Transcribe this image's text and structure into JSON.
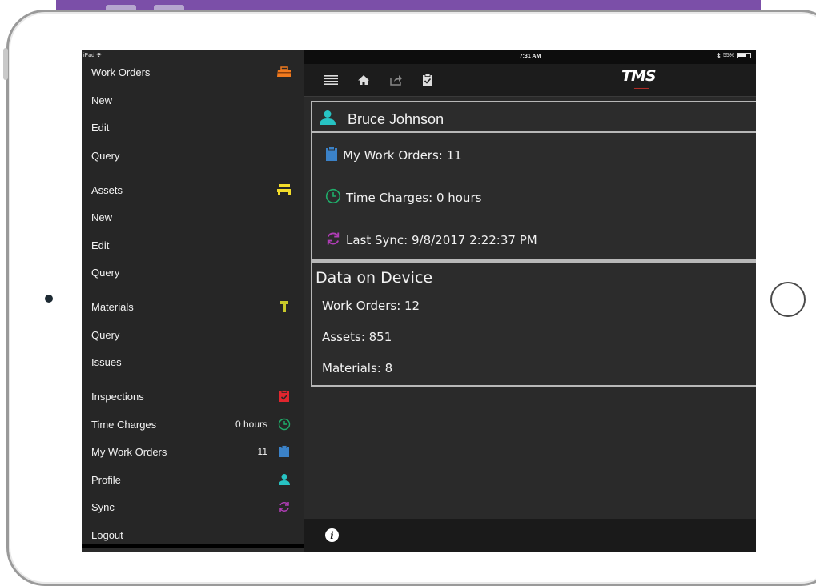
{
  "status_bar": {
    "carrier": "iPad",
    "time": "7:31 AM",
    "battery": "55%"
  },
  "logo": {
    "text": "TMS"
  },
  "sidebar": {
    "work_orders": {
      "label": "Work Orders",
      "icon": "toolbox-icon",
      "color": "#f07a1e"
    },
    "wo_new": "New",
    "wo_edit": "Edit",
    "wo_query": "Query",
    "assets": {
      "label": "Assets",
      "icon": "assets-icon",
      "color": "#f2dc2a"
    },
    "as_new": "New",
    "as_edit": "Edit",
    "as_query": "Query",
    "materials": {
      "label": "Materials",
      "icon": "materials-icon",
      "color": "#c8c82a"
    },
    "mat_query": "Query",
    "mat_issues": "Issues",
    "inspections": {
      "label": "Inspections",
      "icon": "inspection-clipboard-icon",
      "color": "#e0262e"
    },
    "time_charges": {
      "label": "Time Charges",
      "value": "0 hours",
      "icon": "clock-icon",
      "color": "#1fae6a"
    },
    "my_work_orders": {
      "label": "My Work Orders",
      "value": "11",
      "icon": "clipboard-icon",
      "color": "#3b82c8"
    },
    "profile": {
      "label": "Profile",
      "icon": "user-icon",
      "color": "#27c3c3"
    },
    "sync": {
      "label": "Sync",
      "icon": "sync-icon",
      "color": "#b03db6"
    },
    "logout": {
      "label": "Logout"
    }
  },
  "main": {
    "user_name": "Bruce Johnson",
    "my_work_orders": "My Work Orders: 11",
    "time_charges": "Time Charges: 0 hours",
    "last_sync": "Last Sync: 9/8/2017 2:22:37 PM",
    "data_title": "Data on Device",
    "data_work_orders": "Work Orders: 12",
    "data_assets": "Assets: 851",
    "data_materials": "Materials: 8"
  }
}
